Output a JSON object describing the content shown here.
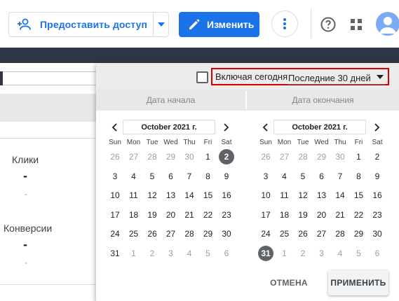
{
  "toolbar": {
    "share_label": "Предоставить доступ",
    "edit_label": "Изменить",
    "accent_color": "#1a73e8"
  },
  "icons": {
    "share": "person-add-icon",
    "share_caret": "caret-down-icon",
    "edit": "pencil-icon",
    "more": "more-vertical-icon",
    "help": "help-icon",
    "apps": "apps-grid-icon",
    "avatar": "avatar-icon"
  },
  "report": {
    "metrics": [
      {
        "label": "Клики",
        "value": "-",
        "sub": "-"
      },
      {
        "label": "Конверсии",
        "value": "-",
        "sub": "-"
      }
    ]
  },
  "date_picker": {
    "include_today_label": "Включая сегодня",
    "include_today_checked": false,
    "range_value": "Последние 30 дней",
    "highlight_color": "#d50000",
    "tabs": {
      "start": "Дата начала",
      "end": "Дата окончания"
    },
    "weekdays": [
      "Sun",
      "Mon",
      "Tue",
      "Wed",
      "Thu",
      "Fri",
      "Sat"
    ],
    "start_calendar": {
      "month": "October 2021 г.",
      "weeks": [
        [
          "26",
          "27",
          "28",
          "29",
          "30",
          "1",
          "2"
        ],
        [
          "3",
          "4",
          "5",
          "6",
          "7",
          "8",
          "9"
        ],
        [
          "10",
          "11",
          "12",
          "13",
          "14",
          "15",
          "16"
        ],
        [
          "17",
          "18",
          "19",
          "20",
          "21",
          "22",
          "23"
        ],
        [
          "24",
          "25",
          "26",
          "27",
          "28",
          "29",
          "30"
        ],
        [
          "31",
          "1",
          "2",
          "3",
          "4",
          "5",
          "6"
        ]
      ],
      "selected_day": "2"
    },
    "end_calendar": {
      "month": "October 2021 г.",
      "weeks": [
        [
          "26",
          "27",
          "28",
          "29",
          "30",
          "1",
          "2"
        ],
        [
          "3",
          "4",
          "5",
          "6",
          "7",
          "8",
          "9"
        ],
        [
          "10",
          "11",
          "12",
          "13",
          "14",
          "15",
          "16"
        ],
        [
          "17",
          "18",
          "19",
          "20",
          "21",
          "22",
          "23"
        ],
        [
          "24",
          "25",
          "26",
          "27",
          "28",
          "29",
          "30"
        ],
        [
          "31",
          "1",
          "2",
          "3",
          "4",
          "5",
          "6"
        ]
      ],
      "selected_day": "31"
    },
    "cancel_label": "ОТМЕНА",
    "apply_label": "ПРИМЕНИТЬ"
  }
}
